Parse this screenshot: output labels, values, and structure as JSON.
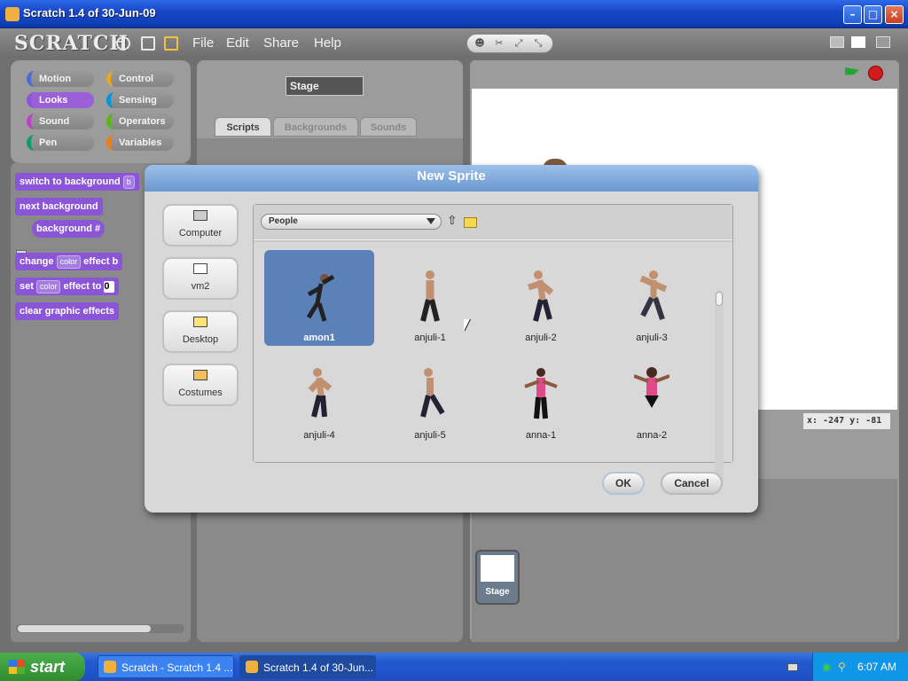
{
  "window": {
    "title": "Scratch 1.4 of 30-Jun-09"
  },
  "menubar": {
    "logo": "SCRATCH",
    "items": [
      "File",
      "Edit",
      "Share",
      "Help"
    ]
  },
  "categories": [
    "Motion",
    "Control",
    "Looks",
    "Sensing",
    "Sound",
    "Operators",
    "Pen",
    "Variables"
  ],
  "category_colors": {
    "Motion": "#4a6cd4",
    "Control": "#e6a822",
    "Looks": "#8a55d7",
    "Sensing": "#0094dd",
    "Sound": "#bb42c3",
    "Operators": "#5cb712",
    "Pen": "#0e9a6c",
    "Variables": "#ee7d16"
  },
  "blocks": {
    "b1_text": "switch to background",
    "b1_slot": "b",
    "b2_text": "next background",
    "b3_text": "background #",
    "b4_pre": "change",
    "b4_slot": "color",
    "b4_post": "effect b",
    "b5_pre": "set",
    "b5_slot": "color",
    "b5_post": "effect to",
    "b5_val": "0",
    "b6_text": "clear graphic effects"
  },
  "center": {
    "object_name": "Stage",
    "tabs": [
      "Scripts",
      "Backgrounds",
      "Sounds"
    ]
  },
  "stage": {
    "coords": "x: -247   y: -81",
    "thumb_label": "Stage"
  },
  "dialog": {
    "title": "New Sprite",
    "locations": [
      "Computer",
      "vm2",
      "Desktop",
      "Costumes"
    ],
    "folder": "People",
    "sprites": [
      "amon1",
      "anjuli-1",
      "anjuli-2",
      "anjuli-3",
      "anjuli-4",
      "anjuli-5",
      "anna-1",
      "anna-2"
    ],
    "selected_sprite": "amon1",
    "ok_label": "OK",
    "cancel_label": "Cancel"
  },
  "taskbar": {
    "start": "start",
    "items": [
      "Scratch - Scratch 1.4 ...",
      "Scratch 1.4 of 30-Jun..."
    ],
    "clock": "6:07 AM"
  }
}
